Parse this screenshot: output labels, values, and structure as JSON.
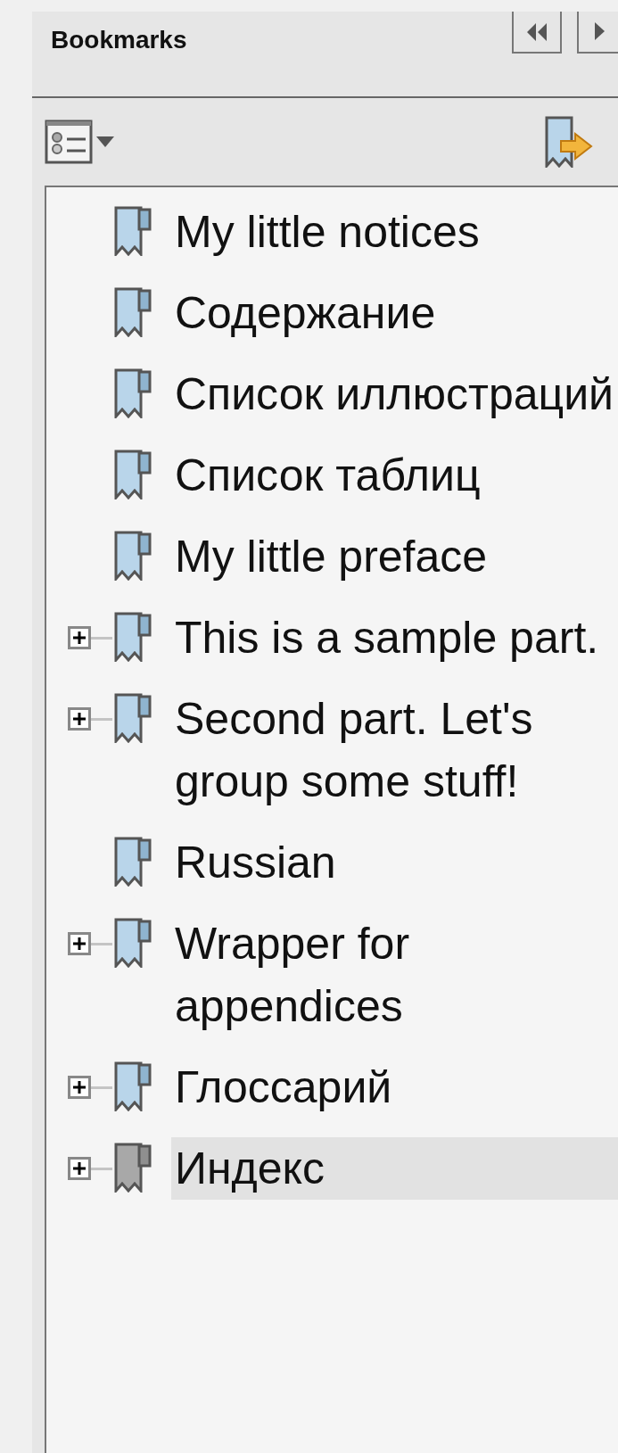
{
  "panel": {
    "title": "Bookmarks"
  },
  "bookmarks": [
    {
      "label": "My little notices",
      "expandable": false,
      "selected": false
    },
    {
      "label": "Содержание",
      "expandable": false,
      "selected": false
    },
    {
      "label": "Список иллюстраций",
      "expandable": false,
      "selected": false
    },
    {
      "label": "Список таблиц",
      "expandable": false,
      "selected": false
    },
    {
      "label": "My little preface",
      "expandable": false,
      "selected": false
    },
    {
      "label": "This is a sample part.",
      "expandable": true,
      "selected": false
    },
    {
      "label": "Second part. Let's group some stuff!",
      "expandable": true,
      "selected": false
    },
    {
      "label": "Russian",
      "expandable": false,
      "selected": false
    },
    {
      "label": "Wrapper for appendices",
      "expandable": true,
      "selected": false
    },
    {
      "label": "Глоссарий",
      "expandable": true,
      "selected": false
    },
    {
      "label": "Индекс",
      "expandable": true,
      "selected": true
    }
  ]
}
